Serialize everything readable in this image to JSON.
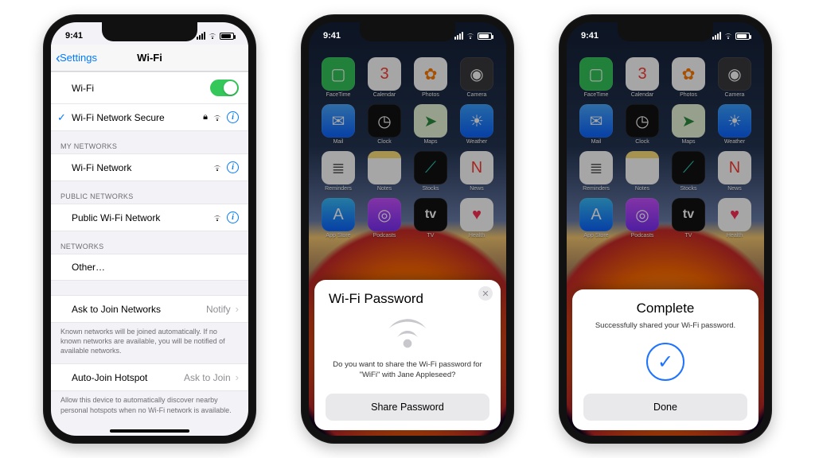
{
  "status": {
    "time1": "9:41",
    "time2": "9:41",
    "time3": "9:41"
  },
  "apps": [
    {
      "label": "FaceTime",
      "bg": "#34c759",
      "glyph": "▢"
    },
    {
      "label": "Calendar",
      "bg": "#ffffff",
      "glyph": "3",
      "fg": "#ff3b30"
    },
    {
      "label": "Photos",
      "bg": "#ffffff",
      "glyph": "✿",
      "fg": "#ff7a00"
    },
    {
      "label": "Camera",
      "bg": "#3a3a3c",
      "glyph": "◉"
    },
    {
      "label": "Mail",
      "bg": "linear-gradient(#4aa8ff,#0a63ff)",
      "glyph": "✉︎"
    },
    {
      "label": "Clock",
      "bg": "#111",
      "glyph": "◷"
    },
    {
      "label": "Maps",
      "bg": "#e8f6d9",
      "glyph": "➤",
      "fg": "#2b8a3e"
    },
    {
      "label": "Weather",
      "bg": "linear-gradient(#3aa0ff,#0a63ff)",
      "glyph": "☀︎"
    },
    {
      "label": "Reminders",
      "bg": "#ffffff",
      "glyph": "≣",
      "fg": "#555"
    },
    {
      "label": "Notes",
      "bg": "linear-gradient(#ffe27a 22%,#fff 22%)",
      "glyph": "",
      "fg": "#b58900"
    },
    {
      "label": "Stocks",
      "bg": "#111",
      "glyph": "⟋",
      "fg": "#2dd4bf"
    },
    {
      "label": "News",
      "bg": "#ffffff",
      "glyph": "N",
      "fg": "#ff3b30"
    },
    {
      "label": "App Store",
      "bg": "linear-gradient(#38bdf8,#0a63ff)",
      "glyph": "A"
    },
    {
      "label": "Podcasts",
      "bg": "linear-gradient(#c850ff,#7b2ff7)",
      "glyph": "◎"
    },
    {
      "label": "TV",
      "bg": "#111",
      "glyph": "tv",
      "fg": "#fff"
    },
    {
      "label": "Health",
      "bg": "#ffffff",
      "glyph": "♥︎",
      "fg": "#ff2d55"
    }
  ],
  "p1": {
    "back": "Settings",
    "title": "Wi-Fi",
    "rows": {
      "wifi_label": "Wi-Fi",
      "connected": "Wi-Fi Network Secure",
      "h_my": "MY NETWORKS",
      "my1": "Wi-Fi Network",
      "h_pub": "PUBLIC NETWORKS",
      "pub1": "Public Wi-Fi Network",
      "h_net": "NETWORKS",
      "other": "Other…",
      "ask": "Ask to Join Networks",
      "ask_val": "Notify",
      "ask_foot": "Known networks will be joined automatically. If no known networks are available, you will be notified of available networks.",
      "auto": "Auto-Join Hotspot",
      "auto_val": "Ask to Join",
      "auto_foot": "Allow this device to automatically discover nearby personal hotspots when no Wi-Fi network is available."
    }
  },
  "p2": {
    "title": "Wi-Fi Password",
    "body": "Do you want to share the Wi-Fi password for \"WiFi\" with Jane Appleseed?",
    "button": "Share Password"
  },
  "p3": {
    "title": "Complete",
    "body": "Successfully shared your Wi-Fi password.",
    "button": "Done"
  }
}
